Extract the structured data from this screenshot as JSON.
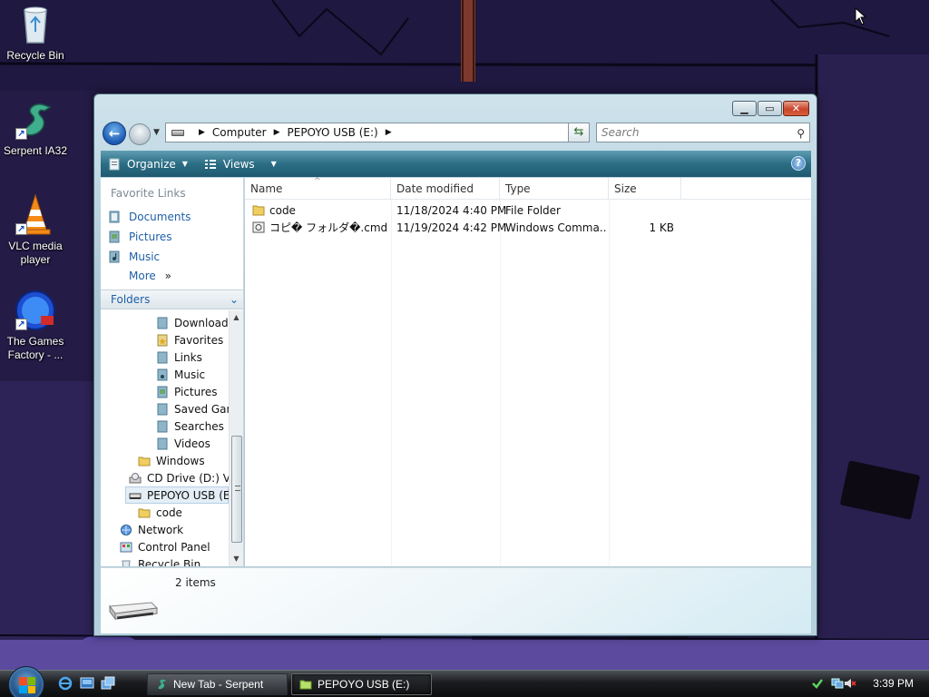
{
  "desktop": {
    "icons": [
      {
        "label": "Recycle Bin",
        "icon": "recycle-bin-icon"
      },
      {
        "label": "Serpent IA32",
        "icon": "serpent-icon"
      },
      {
        "label": "VLC media player",
        "icon": "vlc-cone-icon"
      },
      {
        "label": "The Games Factory - ...",
        "icon": "games-factory-icon"
      }
    ]
  },
  "window": {
    "controls": {
      "minimize": "minimize-icon",
      "maximize": "maximize-icon",
      "close": "close-icon"
    },
    "address": {
      "segments": [
        "Computer",
        "PEPOYO USB (E:)"
      ]
    },
    "search": {
      "placeholder": "Search"
    },
    "toolbar": {
      "organize": "Organize",
      "views": "Views"
    },
    "favorites": {
      "title": "Favorite Links",
      "links": [
        "Documents",
        "Pictures",
        "Music"
      ],
      "more": "More"
    },
    "folders": {
      "title": "Folders",
      "tree": [
        {
          "label": "Downloads",
          "icon": "downloads-folder-icon"
        },
        {
          "label": "Favorites",
          "icon": "favorites-folder-icon"
        },
        {
          "label": "Links",
          "icon": "links-folder-icon"
        },
        {
          "label": "Music",
          "icon": "music-folder-icon"
        },
        {
          "label": "Pictures",
          "icon": "pictures-folder-icon"
        },
        {
          "label": "Saved Games",
          "icon": "saved-games-folder-icon"
        },
        {
          "label": "Searches",
          "icon": "searches-folder-icon"
        },
        {
          "label": "Videos",
          "icon": "videos-folder-icon"
        },
        {
          "label": "Windows",
          "icon": "folder-icon"
        },
        {
          "label": "CD Drive (D:) Vista",
          "icon": "cd-drive-icon"
        },
        {
          "label": "PEPOYO USB (E:)",
          "icon": "usb-drive-icon"
        },
        {
          "label": "code",
          "icon": "folder-icon"
        },
        {
          "label": "Network",
          "icon": "network-icon"
        },
        {
          "label": "Control Panel",
          "icon": "control-panel-icon"
        },
        {
          "label": "Recycle Bin",
          "icon": "recycle-bin-icon"
        }
      ]
    },
    "columns": [
      "Name",
      "Date modified",
      "Type",
      "Size"
    ],
    "files": [
      {
        "name": "code",
        "date": "11/18/2024 4:40 PM",
        "type": "File Folder",
        "size": "",
        "icon": "folder-icon"
      },
      {
        "name": "コピ� フォルダ�.cmd",
        "date": "11/19/2024 4:42 PM",
        "type": "Windows Comma...",
        "size": "1 KB",
        "icon": "cmd-file-icon"
      }
    ],
    "details": {
      "count": "2 items"
    }
  },
  "taskbar": {
    "buttons": [
      {
        "label": "New Tab - Serpent",
        "icon": "serpent-icon"
      },
      {
        "label": "PEPOYO USB (E:)",
        "icon": "folder-icon"
      }
    ],
    "clock": "3:39 PM"
  },
  "colors": {
    "toolbar": "#2c6e85",
    "link": "#1e5fa8",
    "desktop": "#231b45"
  }
}
